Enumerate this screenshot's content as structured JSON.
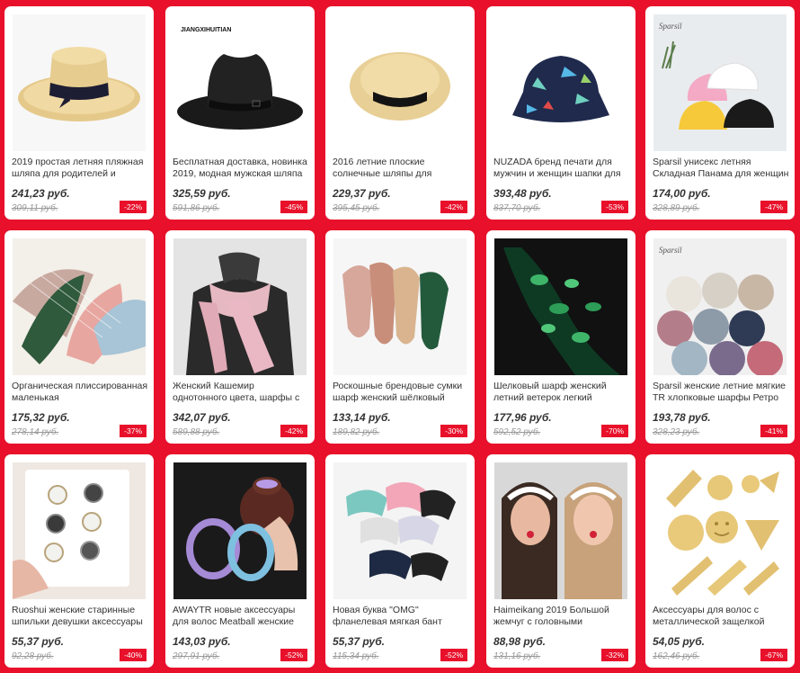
{
  "products": [
    {
      "title": "2019 простая летняя пляжная шляпа для родителей и",
      "price": "241,23 руб.",
      "old_price": "309,11 руб.",
      "discount": "-22%",
      "image": "straw-boater-hat-image"
    },
    {
      "title": "Бесплатная доставка, новинка 2019, модная мужская шляпа",
      "price": "325,59 руб.",
      "old_price": "591,86 руб.",
      "discount": "-45%",
      "image": "black-fedora-hat-image",
      "brand": "JIANGXIHUITIAN"
    },
    {
      "title": "2016 летние плоские солнечные шляпы для",
      "price": "229,37 руб.",
      "old_price": "395,45 руб.",
      "discount": "-42%",
      "image": "flat-straw-hat-image"
    },
    {
      "title": "NUZADA бренд печати для мужчин и женщин шапки для",
      "price": "393,48 руб.",
      "old_price": "837,70 руб.",
      "discount": "-53%",
      "image": "printed-bucket-hat-image"
    },
    {
      "title": "Sparsil унисекс летняя Складная Панама для женщин",
      "price": "174,00 руб.",
      "old_price": "328,89 руб.",
      "discount": "-47%",
      "image": "bucket-hats-image",
      "brand": "Sparsil"
    },
    {
      "title": "Органическая плиссированная маленькая",
      "price": "175,32 руб.",
      "old_price": "278,14 руб.",
      "discount": "-37%",
      "image": "pleated-scarves-image"
    },
    {
      "title": "Женский Кашемир однотонного цвета, шарфы с",
      "price": "342,07 руб.",
      "old_price": "589,88 руб.",
      "discount": "-42%",
      "image": "cashmere-scarf-image"
    },
    {
      "title": "Роскошные брендовые сумки шарф женский шёлковый",
      "price": "133,14 руб.",
      "old_price": "189,82 руб.",
      "discount": "-30%",
      "image": "silk-neck-scarves-image"
    },
    {
      "title": "Шелковый шарф женский летний ветерок легкий",
      "price": "177,96 руб.",
      "old_price": "592,52 руб.",
      "discount": "-70%",
      "image": "leaf-silk-scarf-image"
    },
    {
      "title": "Sparsil женские летние мягкие TR хлопковые шарфы Ретро",
      "price": "193,78 руб.",
      "old_price": "328,23 руб.",
      "discount": "-41%",
      "image": "rolled-scarves-image",
      "brand": "Sparsil"
    },
    {
      "title": "Ruoshui женские старинные шпильки девушки аксессуары",
      "price": "55,37 руб.",
      "old_price": "92,28 руб.",
      "discount": "-40%",
      "image": "pearl-hairpins-image"
    },
    {
      "title": "AWAYTR новые аксессуары для волос Meatball женские",
      "price": "143,03 руб.",
      "old_price": "297,91 руб.",
      "discount": "-52%",
      "image": "rhinestone-hair-rings-image"
    },
    {
      "title": "Новая буква \"OMG\" фланелевая мягкая бант",
      "price": "55,37 руб.",
      "old_price": "115,34 руб.",
      "discount": "-52%",
      "image": "omg-headbands-image"
    },
    {
      "title": "Haimeikang 2019 Большой жемчуг с головными",
      "price": "88,98 руб.",
      "old_price": "131,16 руб.",
      "discount": "-32%",
      "image": "pearl-headbands-image"
    },
    {
      "title": "Аксессуары для волос с металлической защелкой",
      "price": "54,05 руб.",
      "old_price": "162,46 руб.",
      "discount": "-67%",
      "image": "gold-hair-clips-image"
    }
  ]
}
